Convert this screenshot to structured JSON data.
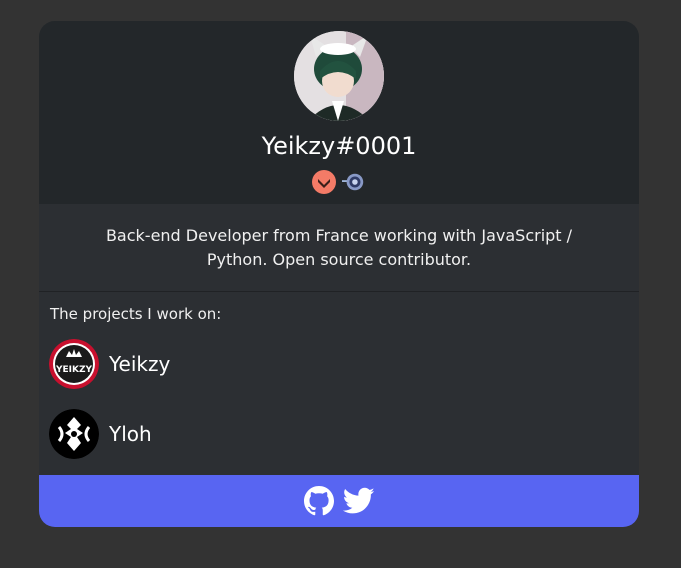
{
  "profile": {
    "username": "Yeikzy#0001",
    "bio": "Back-end Developer from France working with JavaScript / Python. Open source contributor.",
    "badges": [
      {
        "icon": "hypesquad-brilliance-icon",
        "color": "#f47b67"
      },
      {
        "icon": "early-supporter-icon",
        "color": "#8899c6"
      }
    ]
  },
  "projects": {
    "label": "The projects I work on:",
    "items": [
      {
        "name": "Yeikzy",
        "logo_text": "YEIKZY",
        "icon": "yeikzy-logo-icon"
      },
      {
        "name": "Yloh",
        "icon": "yloh-logo-icon"
      }
    ]
  },
  "footer": {
    "links": [
      {
        "icon": "github-icon"
      },
      {
        "icon": "twitter-icon"
      }
    ],
    "color": "#5865f2"
  }
}
